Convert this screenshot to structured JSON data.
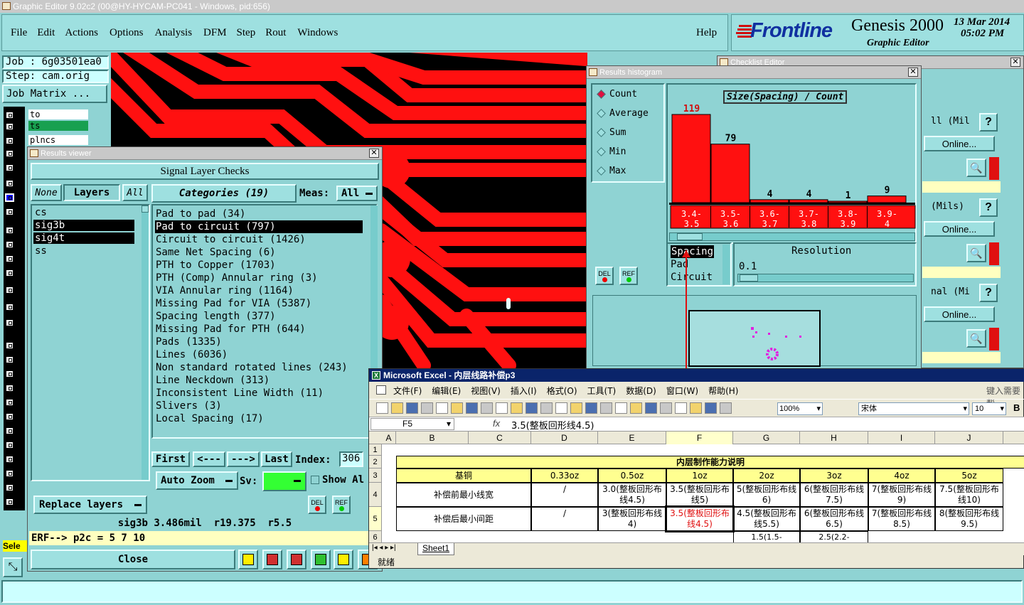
{
  "title_bar": {
    "text": "Graphic Editor 9.02c2 (00@HY-HYCAM-PC041 - Windows, pid:656)"
  },
  "menu": {
    "items": [
      "File",
      "Edit",
      "Actions",
      "Options",
      "Analysis",
      "DFM",
      "Step",
      "Rout",
      "Windows"
    ],
    "help": "Help"
  },
  "brand": {
    "logo": "Frontline",
    "product": "Genesis 2000",
    "subtitle": "Graphic Editor",
    "date": "13 Mar 2014",
    "time": "05:02 PM"
  },
  "job": {
    "job_label": "Job : 6g03501ea0",
    "step_label": "Step: cam.orig",
    "matrix_button": "Job Matrix ..."
  },
  "layer_list": {
    "items": [
      "to",
      "ts",
      "plncs"
    ]
  },
  "selected_status": "Sele",
  "results_viewer": {
    "title": "Results viewer",
    "header": "Signal Layer Checks",
    "none": "None",
    "layers": "Layers",
    "all": "All",
    "categories_label": "Categories (19)",
    "meas_label": "Meas:",
    "meas_value": "All",
    "layer_items": [
      "cs",
      "sig3b",
      "sig4t",
      "ss"
    ],
    "categories": [
      "Pad to pad (34)",
      "Pad to circuit (797)",
      "Circuit to circuit (1426)",
      "Same Net Spacing (6)",
      "PTH to Copper (1703)",
      "PTH (Comp) Annular ring (3)",
      "VIA Annular ring (1164)",
      "Missing Pad for VIA (5387)",
      "Spacing length (377)",
      "Missing Pad for PTH (644)",
      "Pads (1335)",
      "Lines (6036)",
      "Non standard rotated lines (243)",
      "Line Neckdown (313)",
      "Inconsistent Line Width (11)",
      "Slivers (3)",
      "Local Spacing (17)"
    ],
    "nav": {
      "first": "First",
      "prev": "<---",
      "next": "--->",
      "last": "Last",
      "index_label": "Index:",
      "index_value": "306"
    },
    "auto_zoom": "Auto Zoom",
    "sv_label": "Sv:",
    "show_all": "Show Al",
    "replace_layers": "Replace layers",
    "del": "DEL",
    "ref": "REF",
    "status_line": "sig3b 3.486mil  r19.375  r5.5",
    "erf_line": "ERF--> p2c = 5 7 10",
    "close": "Close"
  },
  "checklist": {
    "title": "Checklist Editor",
    "rows": [
      {
        "label": "ll (Mil",
        "online": "Online..."
      },
      {
        "label": "(Mils)",
        "online": "Online..."
      },
      {
        "label": "nal (Mi",
        "online": "Online..."
      }
    ]
  },
  "histogram": {
    "title": "Results histogram",
    "options": [
      "Count",
      "Average",
      "Sum",
      "Min",
      "Max"
    ],
    "chart_title": "Size(Spacing) / Count",
    "del": "DEL",
    "ref": "REF",
    "metrics": [
      "Spacing",
      "Pad",
      "Circuit"
    ],
    "resolution_label": "Resolution",
    "resolution_value": "0.1"
  },
  "chart_data": {
    "type": "bar",
    "title": "Size(Spacing) / Count",
    "categories": [
      "3.4-3.5",
      "3.5-3.6",
      "3.6-3.7",
      "3.7-3.8",
      "3.8-3.9",
      "3.9-4"
    ],
    "values": [
      119,
      79,
      4,
      4,
      1,
      9
    ],
    "ylim": [
      0,
      119
    ],
    "color": "#ff1010"
  },
  "excel": {
    "title": "Microsoft Excel - 内层线路补偿p3",
    "menu": [
      "文件(F)",
      "编辑(E)",
      "视图(V)",
      "插入(I)",
      "格式(O)",
      "工具(T)",
      "数据(D)",
      "窗口(W)",
      "帮助(H)"
    ],
    "help_hint": "键入需要帮",
    "zoom": "100%",
    "font": "宋体",
    "size": "10",
    "bold": "B",
    "cell_ref": "F5",
    "fx": "fx",
    "formula": "3.5(整板回形线4.5)",
    "columns": [
      "A",
      "B",
      "C",
      "D",
      "E",
      "F",
      "G",
      "H",
      "I",
      "J"
    ],
    "rows": [
      "1",
      "2",
      "3",
      "4",
      "5",
      "6"
    ],
    "heading": "内层制作能力说明",
    "header_row": [
      "基铜",
      "0.33oz",
      "0.5oz",
      "1oz",
      "2oz",
      "3oz",
      "4oz",
      "5oz"
    ],
    "row4": [
      "补偿前最小线宽",
      "/",
      "3.0(整板回形布线4.5)",
      "3.5(整板回形布线5)",
      "5(整板回形布线6)",
      "6(整板回形布线7.5)",
      "7(整板回形布线9)",
      "7.5(整板回形布线10)"
    ],
    "row5": [
      "补偿后最小间距",
      "/",
      "3(整板回形布线4)",
      "3.5(整板回形布线4.5)",
      "4.5(整板回形布线5.5)",
      "6(整板回形布线6.5)",
      "7(整板回形布线8.5)",
      "8(整板回形布线9.5)"
    ],
    "row6": [
      "1.5(1.5-",
      "2.5(2.2-"
    ],
    "sheet_tab": "Sheet1",
    "status": "就绪"
  }
}
